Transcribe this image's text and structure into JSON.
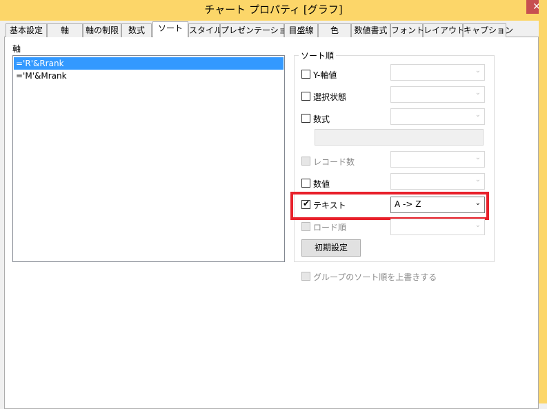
{
  "window": {
    "title": "チャート プロパティ [グラフ]",
    "close_glyph": "✕"
  },
  "tabs": [
    {
      "label": "基本設定",
      "active": false
    },
    {
      "label": "軸",
      "active": false
    },
    {
      "label": "軸の制限",
      "active": false
    },
    {
      "label": "数式",
      "active": false
    },
    {
      "label": "ソート",
      "active": true
    },
    {
      "label": "スタイル",
      "active": false
    },
    {
      "label": "プレゼンテーション",
      "active": false
    },
    {
      "label": "目盛線",
      "active": false
    },
    {
      "label": "色",
      "active": false
    },
    {
      "label": "数値書式",
      "active": false
    },
    {
      "label": "フォント",
      "active": false
    },
    {
      "label": "レイアウト",
      "active": false
    },
    {
      "label": "キャプション",
      "active": false
    }
  ],
  "axis_panel": {
    "label": "軸",
    "items": [
      {
        "text": "='R'&Rrank",
        "selected": true
      },
      {
        "text": "='M'&Mrank",
        "selected": false
      }
    ]
  },
  "sort_group": {
    "title": "ソート順",
    "options": [
      {
        "label": "Y-軸値",
        "checked": false,
        "enabled": true,
        "select_value": ""
      },
      {
        "label": "選択状態",
        "checked": false,
        "enabled": true,
        "select_value": ""
      },
      {
        "label": "数式",
        "checked": false,
        "enabled": true,
        "select_value": ""
      },
      {
        "label": "レコード数",
        "checked": false,
        "enabled": false,
        "select_value": ""
      },
      {
        "label": "数値",
        "checked": false,
        "enabled": true,
        "select_value": ""
      },
      {
        "label": "テキスト",
        "checked": true,
        "enabled": true,
        "select_value": "A -> Z"
      },
      {
        "label": "ロード順",
        "checked": false,
        "enabled": false,
        "select_value": ""
      }
    ],
    "reset_button": "初期設定"
  },
  "override_group_sort": {
    "label": "グループのソート順を上書きする",
    "checked": false,
    "enabled": false
  },
  "colors": {
    "titlebar": "#fcd669",
    "selection": "#3399ff",
    "highlight": "#e8202a"
  }
}
